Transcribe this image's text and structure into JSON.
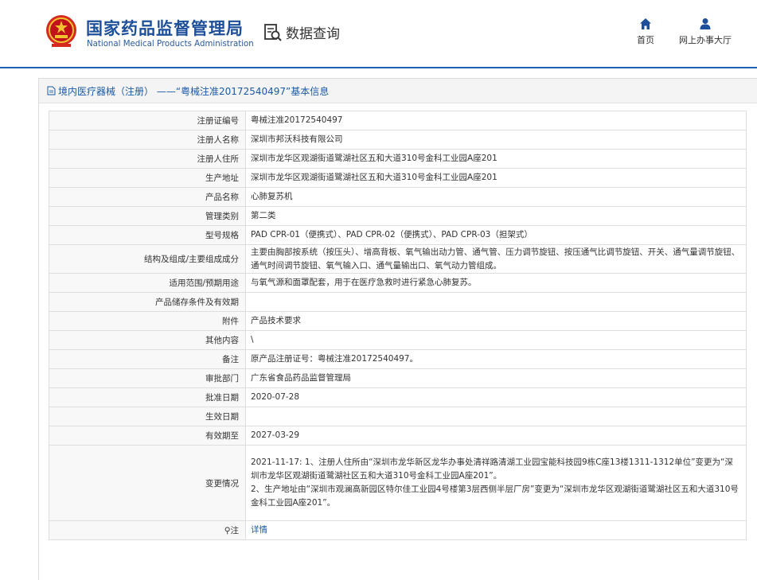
{
  "header": {
    "logo_cn": "国家药品监督管理局",
    "logo_en": "National Medical Products Administration",
    "query_label": "数据查询",
    "nav": [
      {
        "label": "首页",
        "icon": "home-icon"
      },
      {
        "label": "网上办事大厅",
        "icon": "user-icon"
      }
    ],
    "accent_color": "#1b63b3"
  },
  "panel": {
    "title": "境内医疗器械（注册） ——“粤械注准20172540497”基本信息"
  },
  "rows": [
    {
      "label": "注册证编号",
      "value": "粤械注准20172540497"
    },
    {
      "label": "注册人名称",
      "value": "深圳市邦沃科技有限公司"
    },
    {
      "label": "注册人住所",
      "value": "深圳市龙华区观湖街道鹭湖社区五和大道310号金科工业园A座201"
    },
    {
      "label": "生产地址",
      "value": "深圳市龙华区观湖街道鹭湖社区五和大道310号金科工业园A座201"
    },
    {
      "label": "产品名称",
      "value": "心肺复苏机"
    },
    {
      "label": "管理类别",
      "value": "第二类"
    },
    {
      "label": "型号规格",
      "value": "PAD CPR-01（便携式）、PAD CPR-02（便携式）、PAD CPR-03（担架式）"
    },
    {
      "label": "结构及组成/主要组成成分",
      "value": "主要由胸部按系统（按压头）、增高背板、氧气输出动力管、通气管、压力调节旋钮、按压通气比调节旋钮、开关、通气量调节旋钮、通气时间调节旋钮、氧气输入口、通气量输出口、氧气动力管组成。"
    },
    {
      "label": "适用范围/预期用途",
      "value": "与氧气源和面罩配套，用于在医疗急救时进行紧急心肺复苏。"
    },
    {
      "label": "产品储存条件及有效期",
      "value": ""
    },
    {
      "label": "附件",
      "value": "产品技术要求"
    },
    {
      "label": "其他内容",
      "value": "\\"
    },
    {
      "label": "备注",
      "value": "原产品注册证号：粤械注准20172540497。"
    },
    {
      "label": "审批部门",
      "value": "广东省食品药品监督管理局"
    },
    {
      "label": "批准日期",
      "value": "2020-07-28"
    },
    {
      "label": "生效日期",
      "value": ""
    },
    {
      "label": "有效期至",
      "value": "2027-03-29"
    }
  ],
  "change": {
    "label": "变更情况",
    "line1": "2021-11-17: 1、注册人住所由“深圳市龙华新区龙华办事处清祥路清湖工业园宝能科技园9栋C座13楼1311-1312单位”变更为“深圳市龙华区观湖街道鹭湖社区五和大道310号金科工业园A座201”。",
    "line2": "2、生产地址由“深圳市观澜高新园区特尔佳工业园4号楼第3层西侧半层厂房”变更为“深圳市龙华区观湖街道鹭湖社区五和大道310号金科工业园A座201”。"
  },
  "note": {
    "label": "注",
    "link": "详情"
  }
}
